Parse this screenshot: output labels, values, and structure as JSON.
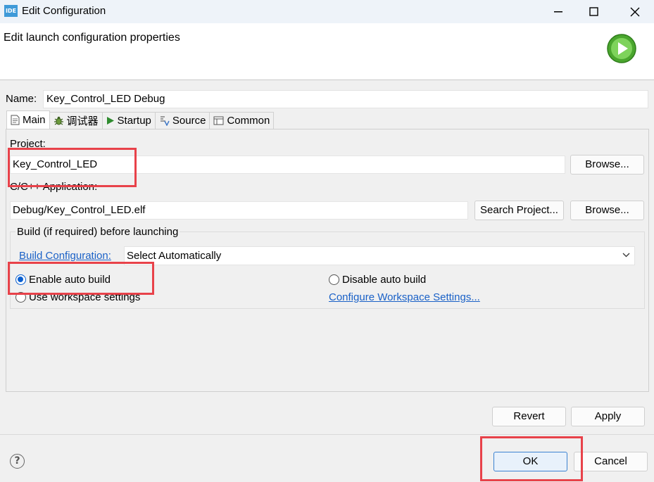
{
  "window": {
    "app_icon_text": "IDE",
    "title": "Edit Configuration"
  },
  "header": {
    "title": "Edit launch configuration properties"
  },
  "name": {
    "label": "Name:",
    "value": "Key_Control_LED Debug"
  },
  "tabs": [
    {
      "label": "Main",
      "icon": "document-icon",
      "active": true
    },
    {
      "label": "调试器",
      "icon": "bug-icon",
      "active": false
    },
    {
      "label": "Startup",
      "icon": "play-icon",
      "active": false
    },
    {
      "label": "Source",
      "icon": "source-icon",
      "active": false
    },
    {
      "label": "Common",
      "icon": "common-icon",
      "active": false
    }
  ],
  "main": {
    "project_label": "Project:",
    "project_value": "Key_Control_LED",
    "project_browse": "Browse...",
    "application_label": "C/C++ Application:",
    "application_value": "Debug/Key_Control_LED.elf",
    "search_project": "Search Project...",
    "application_browse": "Browse...",
    "build_group_title": "Build (if required) before launching",
    "build_config_link": "Build Configuration:",
    "build_config_value": "Select Automatically",
    "radio_enable": "Enable auto build",
    "radio_disable": "Disable auto build",
    "radio_workspace": "Use workspace settings",
    "configure_link": "Configure Workspace Settings...",
    "selected_radio": "Enable auto build"
  },
  "actions": {
    "revert": "Revert",
    "apply": "Apply",
    "ok": "OK",
    "cancel": "Cancel",
    "help": "?"
  },
  "colors": {
    "highlight": "#e8424a",
    "link": "#1a61c7",
    "accent": "#0a5fd0"
  }
}
